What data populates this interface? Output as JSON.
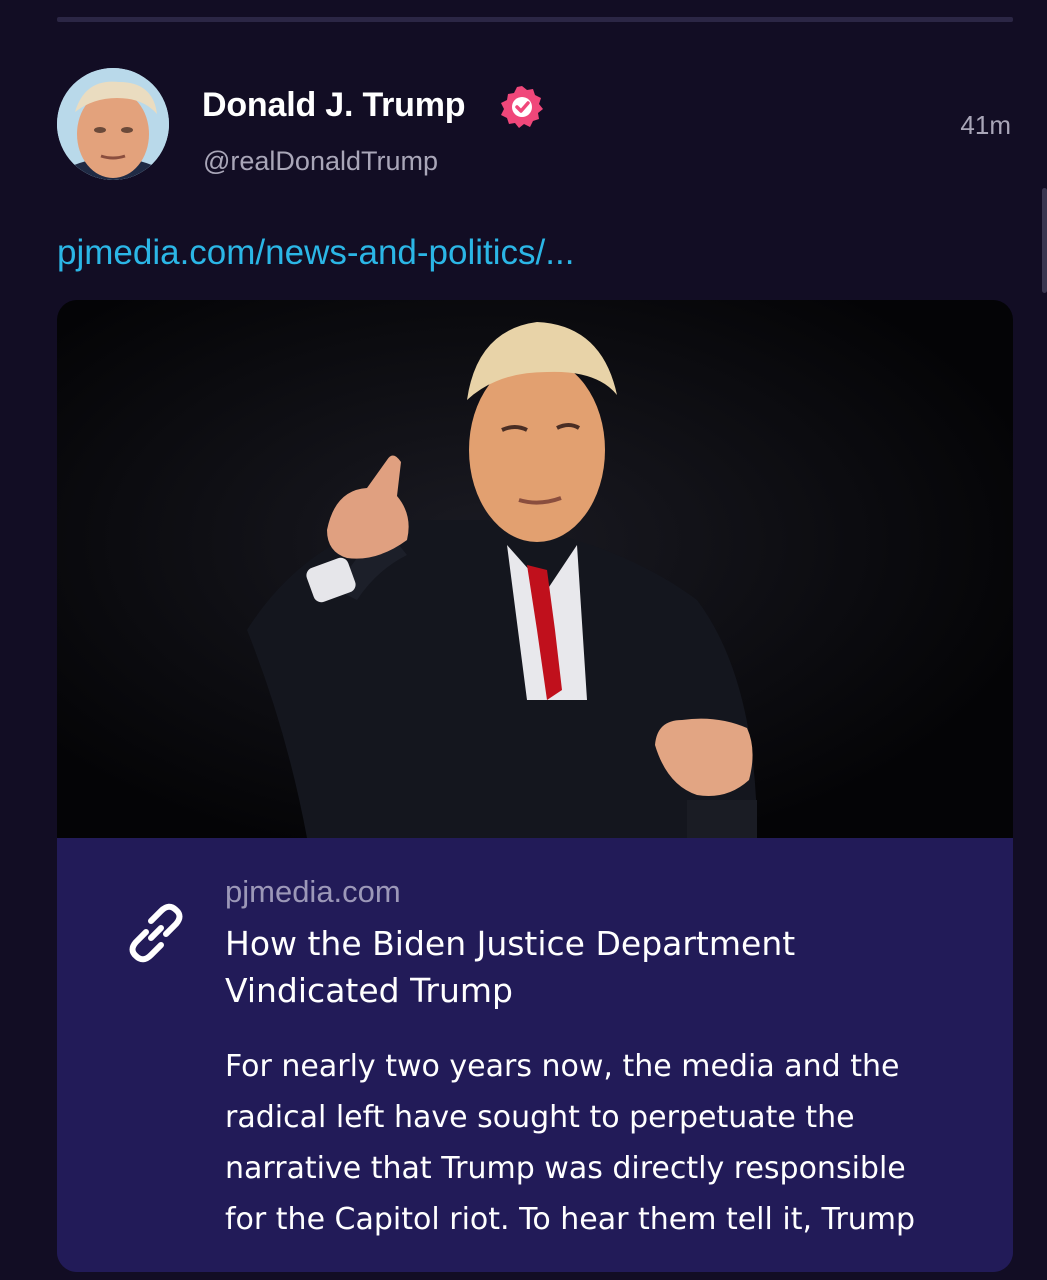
{
  "post": {
    "author": {
      "display_name": "Donald J. Trump",
      "handle": "@realDonaldTrump",
      "verified": true,
      "avatar_icon": "avatar-photo"
    },
    "timestamp": "41m",
    "link_text": "pjmedia.com/news-and-politics/...",
    "link_card": {
      "image_icon": "article-photo",
      "domain": "pjmedia.com",
      "title": "How the Biden Justice Department Vindicated Trump",
      "description": "For nearly two years now, the media and the\nradical left have sought to perpetuate the\nnarrative that Trump was directly responsible\nfor the Capitol riot. To hear them tell it, Trump"
    }
  },
  "colors": {
    "background": "#120d24",
    "link": "#2bb6e6",
    "verified_badge": "#f0477a",
    "card_background": "#221b58",
    "muted_text": "#a9a6b8"
  }
}
